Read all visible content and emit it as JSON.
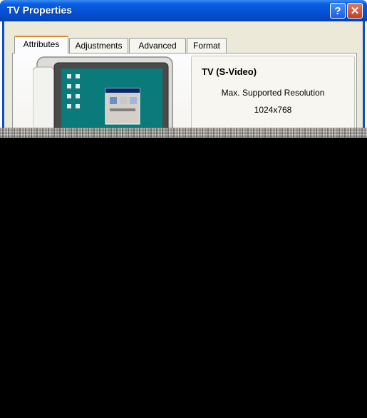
{
  "window": {
    "title": "TV Properties",
    "help_glyph": "?",
    "close_glyph": "✕"
  },
  "tabs": [
    {
      "label": "Attributes",
      "active": true
    },
    {
      "label": "Adjustments",
      "active": false
    },
    {
      "label": "Advanced",
      "active": false
    },
    {
      "label": "Format",
      "active": false
    }
  ],
  "device": {
    "name": "TV (S-Video)",
    "resolution_label": "Max. Supported Resolution",
    "resolution_value": "1024x768"
  },
  "colors": {
    "titlebar": "#0653d8",
    "client_bg": "#ece9d8",
    "active_tab_accent": "#e68b2c"
  }
}
